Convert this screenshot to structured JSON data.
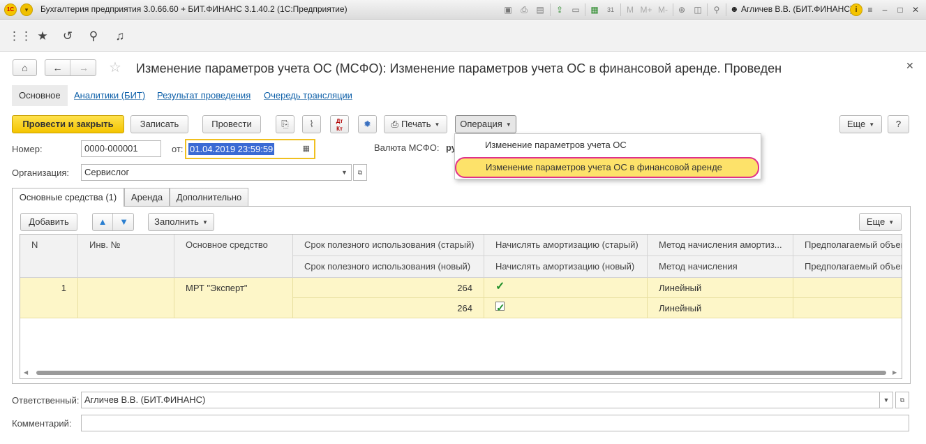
{
  "window": {
    "title": "Бухгалтерия предприятия 3.0.66.60 + БИТ.ФИНАНС 3.1.40.2  (1С:Предприятие)",
    "user": "Агличев В.В. (БИТ.ФИНАНС)",
    "toolbar_icons": [
      "save-icon",
      "print-icon",
      "preview-icon",
      "upload-icon",
      "printer-settings-icon",
      "calculator-icon",
      "calendar-icon",
      "memory-m-icon",
      "memory-plus-icon",
      "memory-minus-icon",
      "zoom-icon",
      "window-icon",
      "tools-icon",
      "info-icon",
      "menu-icon",
      "minimize-icon",
      "maximize-icon",
      "close-icon"
    ],
    "memory_labels": {
      "m": "M",
      "mplus": "M+",
      "mminus": "M-"
    },
    "calendar_day": "31"
  },
  "form": {
    "title": "Изменение параметров учета ОС (МСФО): Изменение параметров учета ОС в финансовой аренде. Проведен",
    "tabs": [
      {
        "label": "Основное",
        "active": true
      },
      {
        "label": "Аналитики (БИТ)",
        "active": false
      },
      {
        "label": "Результат проведения",
        "active": false
      },
      {
        "label": "Очередь трансляции",
        "active": false
      }
    ]
  },
  "toolbar": {
    "post_close": "Провести и закрыть",
    "save": "Записать",
    "post": "Провести",
    "print": "Печать",
    "operation": "Операция",
    "more": "Еще",
    "help": "?"
  },
  "fields": {
    "number_label": "Номер:",
    "number_value": "0000-000001",
    "date_label": "от:",
    "date_value": "01.04.2019 23:59:59",
    "currency_label": "Валюта МСФО:",
    "currency_value": "ру",
    "org_label": "Организация:",
    "org_value": "Сервислог",
    "responsible_label": "Ответственный:",
    "responsible_value": "Агличев В.В. (БИТ.ФИНАНС)",
    "comment_label": "Комментарий:",
    "comment_value": ""
  },
  "operation_menu": {
    "items": [
      "Изменение параметров учета ОС",
      "Изменение параметров учета ОС в финансовой аренде"
    ],
    "highlighted_index": 1
  },
  "inner_tabs": [
    {
      "label": "Основные средства (1)",
      "active": true
    },
    {
      "label": "Аренда",
      "active": false
    },
    {
      "label": "Дополнительно",
      "active": false
    }
  ],
  "table_toolbar": {
    "add": "Добавить",
    "fill": "Заполнить",
    "more": "Еще"
  },
  "table": {
    "headers_top": [
      "N",
      "Инв. №",
      "Основное средство",
      "Срок полезного использования (старый)",
      "Начислять амортизацию (старый)",
      "Метод начисления амортиз...",
      "Предполагаемый объем"
    ],
    "headers_bottom": [
      "Срок полезного использования (новый)",
      "Начислять амортизацию (новый)",
      "Метод начисления",
      "Предполагаемый объем"
    ],
    "rows": [
      {
        "n": "1",
        "inv": "",
        "asset": "МРТ \"Эксперт\"",
        "term_old": "264",
        "term_new": "264",
        "depr_old": true,
        "depr_new": true,
        "method_old": "Линейный",
        "method_new": "Линейный",
        "volume_old": "",
        "volume_new": ""
      }
    ]
  }
}
